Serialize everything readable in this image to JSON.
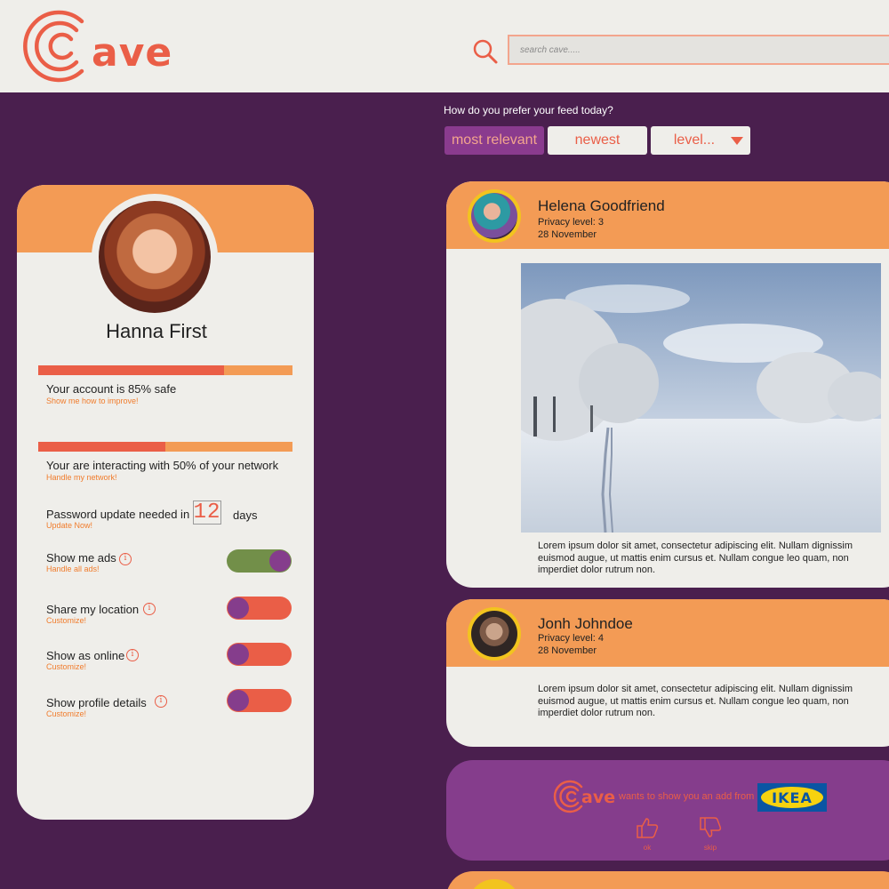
{
  "app": {
    "name": "Cave"
  },
  "search": {
    "placeholder": "search cave....."
  },
  "feed": {
    "question": "How do you prefer your feed today?",
    "options": [
      {
        "label": "most relevant",
        "active": true
      },
      {
        "label": "newest",
        "active": false
      },
      {
        "label": "level...",
        "active": false
      }
    ]
  },
  "profile": {
    "name": "Hanna First",
    "safety": {
      "text": "Your account is 85% safe",
      "link": "Show me how to improve!",
      "progress": 0.73
    },
    "network": {
      "text": "Your are interacting with 50% of your network",
      "link": "Handle my network!",
      "progress": 0.5
    },
    "password": {
      "text": "Password update needed in",
      "days_value": "12",
      "days_label": "days",
      "link": "Update Now!"
    },
    "settings": [
      {
        "label": "Show me ads",
        "link": "Handle all ads!",
        "on": true
      },
      {
        "label": "Share my location",
        "link": "Customize!",
        "on": false
      },
      {
        "label": "Show as online",
        "link": "Customize!",
        "on": false
      },
      {
        "label": "Show profile details",
        "link": "Customize!",
        "on": false
      }
    ],
    "info_icon": "i"
  },
  "posts": [
    {
      "author": "Helena Goodfriend",
      "privacy": "Privacy level: 3",
      "date": "28 November",
      "text": "Lorem ipsum dolor sit amet, consectetur adipiscing elit. Nullam dignissim euismod augue, ut mattis enim cursus et. Nullam congue leo quam, non imperdiet dolor rutrum non."
    },
    {
      "author": "Jonh Johndoe",
      "privacy": "Privacy level: 4",
      "date": "28 November",
      "text": "Lorem ipsum dolor sit amet, consectetur adipiscing elit. Nullam dignissim euismod augue, ut mattis enim cursus et. Nullam congue leo quam, non imperdiet dolor rutrum non."
    }
  ],
  "ad": {
    "brand": "ave",
    "text": "wants to show you an add from",
    "advertiser": "IKEA",
    "ok": "ok",
    "skip": "skip"
  },
  "colors": {
    "purple_bg": "#4a1f4e",
    "orange": "#f39b55",
    "coral": "#ea5e47",
    "light": "#efeeea",
    "violet": "#853d8c",
    "green": "#728f49"
  }
}
